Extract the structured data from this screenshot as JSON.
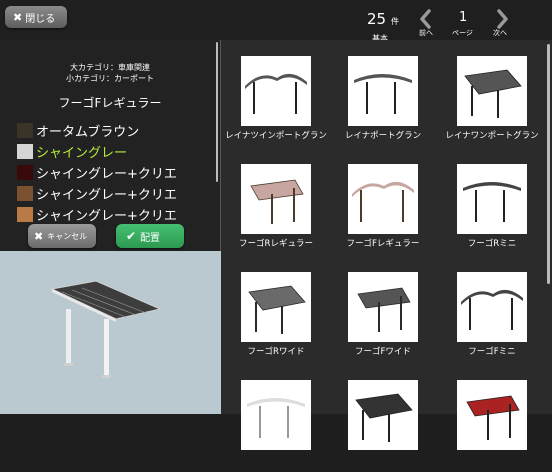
{
  "toolbar": {
    "close_label": "閉じる",
    "close_icon": "x-icon",
    "count": "25",
    "count_unit": "件",
    "sort_label": "基本",
    "prev_label": "前へ",
    "page": "1",
    "page_unit": "ページ",
    "next_label": "次へ"
  },
  "left_panel": {
    "category_major": "大カテゴリ：車庫関連",
    "category_minor": "小カテゴリ：カーポート",
    "product_name": "フーゴFレギュラー",
    "colors": [
      {
        "name": "オータムブラウン",
        "swatch": "#3a3327",
        "selected": false
      },
      {
        "name": "シャイングレー",
        "swatch": "#d5d5d5",
        "selected": true
      },
      {
        "name": "シャイングレー+クリエ",
        "swatch": "#3a0a0a",
        "selected": false
      },
      {
        "name": "シャイングレー+クリエ",
        "swatch": "#7a5131",
        "selected": false
      },
      {
        "name": "シャイングレー+クリエ",
        "swatch": "#b97a45",
        "selected": false
      }
    ],
    "cancel_label": "キャンセル",
    "place_label": "配置",
    "highlight_color": "#b8f03a",
    "place_color": "#3aae5f"
  },
  "products": [
    {
      "name": "レイナツインポートグラン",
      "roof": "#555555",
      "posts": "#222222"
    },
    {
      "name": "レイナポートグラン",
      "roof": "#555555",
      "posts": "#222222"
    },
    {
      "name": "レイナワンポートグラン",
      "roof": "#555555",
      "posts": "#222222"
    },
    {
      "name": "フーゴRレギュラー",
      "roof": "#c7a5a0",
      "posts": "#4a3a2a"
    },
    {
      "name": "フーゴFレギュラー",
      "roof": "#c7a5a0",
      "posts": "#4a3a2a"
    },
    {
      "name": "フーゴRミニ",
      "roof": "#444444",
      "posts": "#222222"
    },
    {
      "name": "フーゴRワイド",
      "roof": "#6a6a6a",
      "posts": "#2a2a2a"
    },
    {
      "name": "フーゴFワイド",
      "roof": "#555555",
      "posts": "#2a2a2a"
    },
    {
      "name": "フーゴFミニ",
      "roof": "#444444",
      "posts": "#222222"
    },
    {
      "name": "",
      "roof": "#dddddd",
      "posts": "#999999"
    },
    {
      "name": "",
      "roof": "#333333",
      "posts": "#222222"
    },
    {
      "name": "",
      "roof": "#aa2222",
      "posts": "#222222"
    }
  ]
}
